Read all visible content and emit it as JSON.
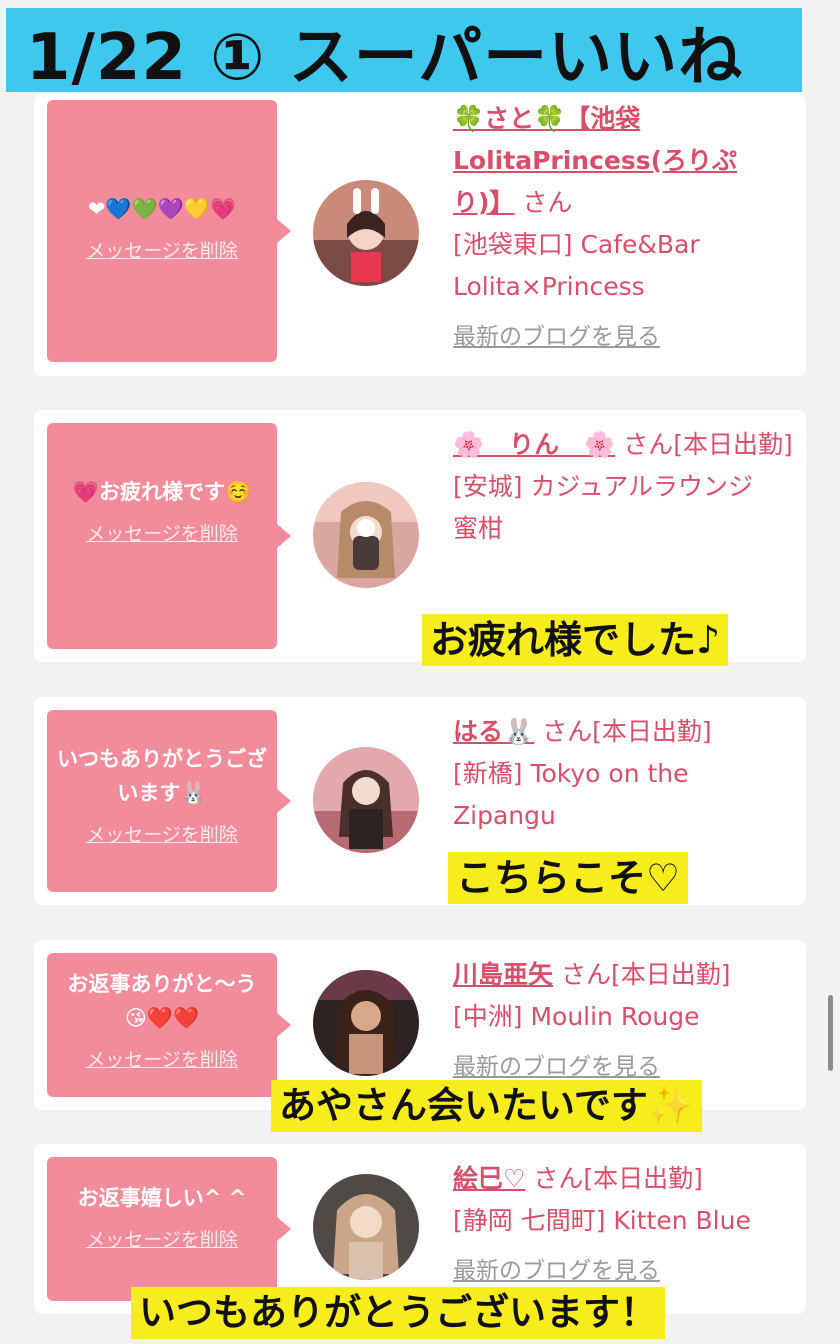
{
  "title": "1/22 ① スーパーいいね",
  "cards": [
    {
      "message": "❤︎💙💚💜💛💗",
      "delete_label": "メッセージを削除",
      "name": "🍀さと🍀【池袋LolitaPrincess(ろりぷり)】",
      "suffix": "さん",
      "shop": "[池袋東口] Cafe&Bar Lolita×Princess",
      "blog_label": "最新のブログを見る"
    },
    {
      "message": "💗お疲れ様です☺️",
      "delete_label": "メッセージを削除",
      "name": "🌸　りん　🌸",
      "suffix": "さん[本日出勤]",
      "shop": "[安城] カジュアルラウンジ　蜜柑",
      "caption": "お疲れ様でした♪"
    },
    {
      "message": "いつもありがとうございます🐰",
      "delete_label": "メッセージを削除",
      "name": "はる🐰",
      "suffix": "さん[本日出勤]",
      "shop": "[新橋] Tokyo on the Zipangu",
      "caption": "こちらこそ♡"
    },
    {
      "message": "お返事ありがと〜う😘❤️❤️",
      "delete_label": "メッセージを削除",
      "name": "川島亜矢",
      "suffix": "さん[本日出勤]",
      "shop": "[中洲] Moulin Rouge",
      "blog_label": "最新のブログを見る",
      "caption": "あやさん会いたいです✨"
    },
    {
      "message": "お返事嬉しい^ ^",
      "delete_label": "メッセージを削除",
      "name": "絵巳♡",
      "suffix": "さん[本日出勤]",
      "shop": "[静岡 七間町] Kitten Blue",
      "blog_label": "最新のブログを見る",
      "caption": "いつもありがとうございます！"
    }
  ]
}
